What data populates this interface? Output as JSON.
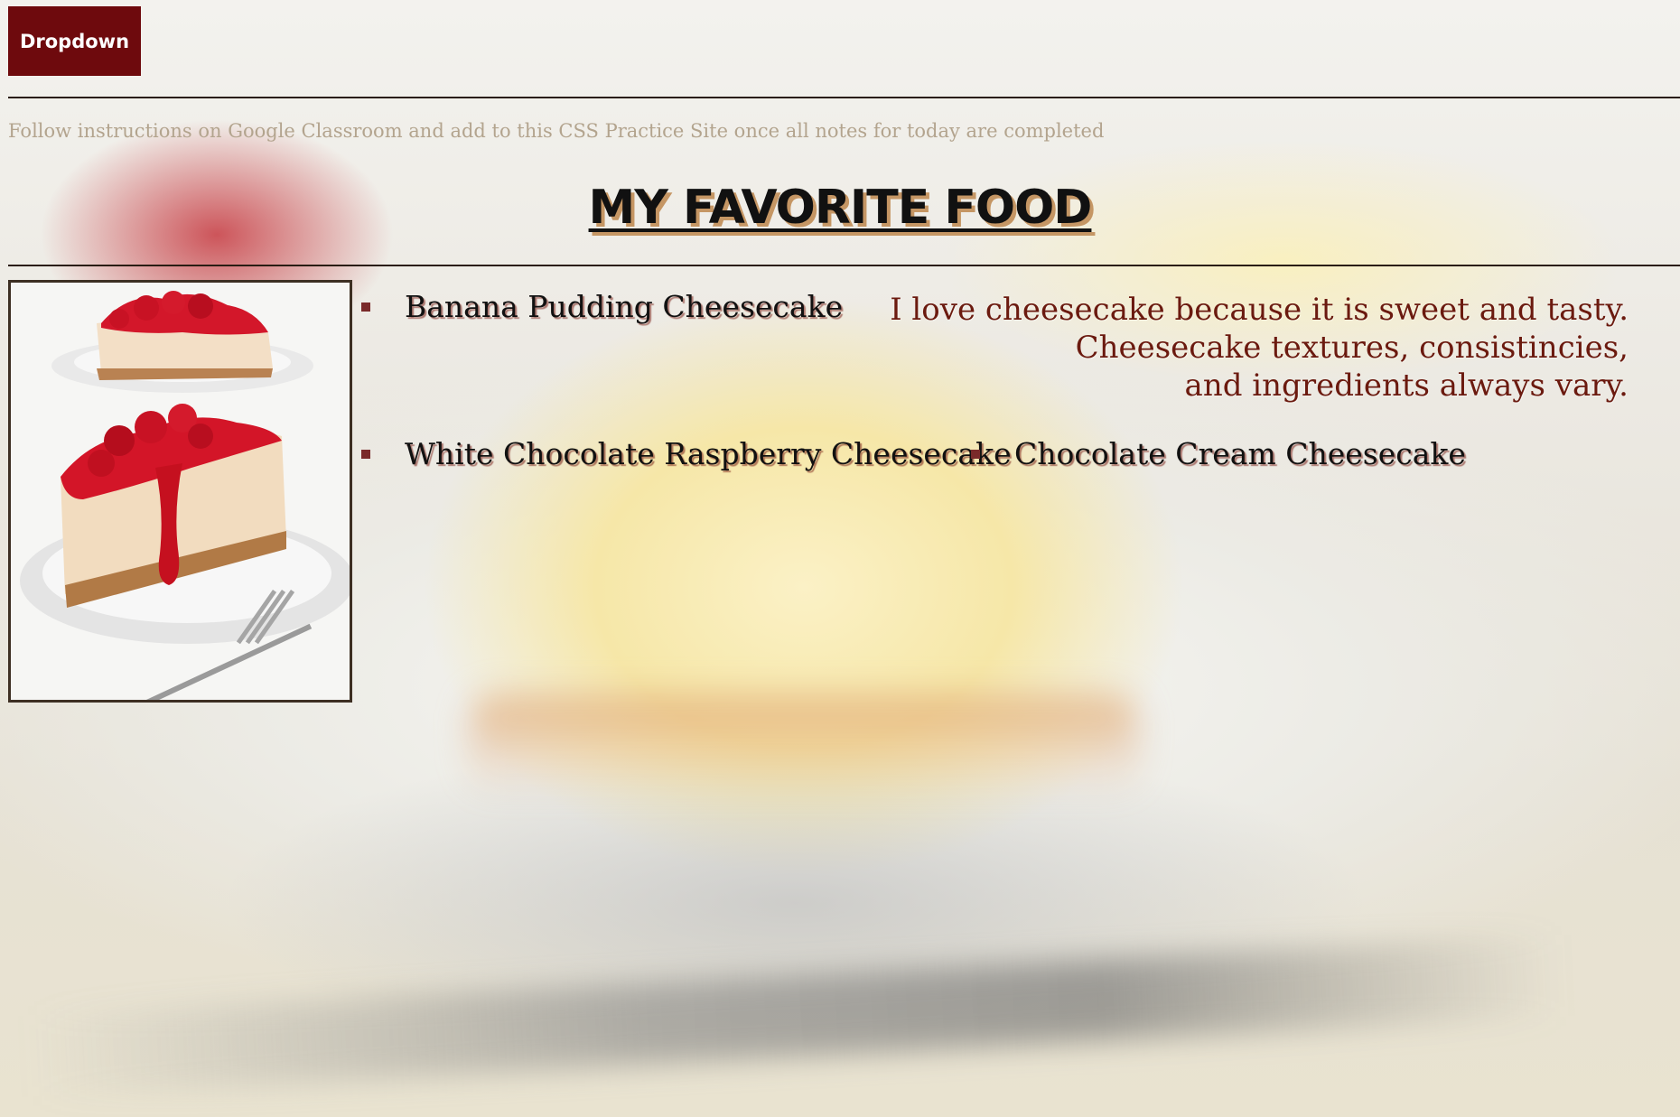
{
  "nav": {
    "dropdown_label": "Dropdown"
  },
  "header": {
    "instructions": "Follow instructions on Google Classroom and add to this CSS Practice Site once all notes for today are completed",
    "title": "MY FAVORITE FOOD"
  },
  "main": {
    "image_alt": "cheesecake-slices",
    "items": [
      {
        "label": "Banana Pudding Cheesecake"
      },
      {
        "label": "White Chocolate Raspberry Cheesecake"
      },
      {
        "label": "Chocolate Cream Cheesecake"
      }
    ],
    "description_lines": [
      "I love cheesecake because it is sweet and tasty.",
      "Cheesecake textures, consistincies,",
      "and ingredients always vary."
    ]
  },
  "colors": {
    "accent": "#6e0a0d",
    "title_shadow": "#c59664",
    "description_text": "#6b1a0f",
    "instructions_text": "#b3a48e",
    "bullet": "#7a2a2a"
  },
  "icons": {
    "bullet": "square-bullet-icon"
  }
}
